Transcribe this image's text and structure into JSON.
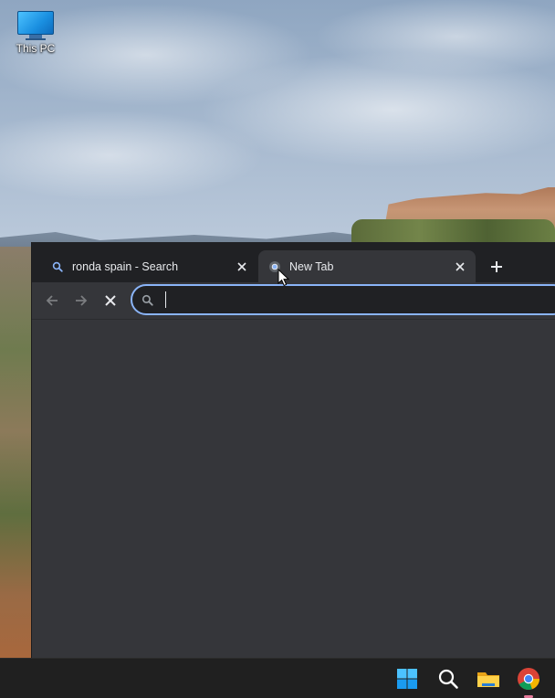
{
  "desktop": {
    "icons": [
      {
        "label": "This PC",
        "icon": "monitor-icon"
      }
    ]
  },
  "browser": {
    "tabs": [
      {
        "title": "ronda spain - Search",
        "icon": "search-icon",
        "active": false
      },
      {
        "title": "New Tab",
        "icon": "chrome-icon",
        "active": true
      }
    ],
    "new_tab_icon": "plus-icon",
    "nav": {
      "back_icon": "arrow-left-icon",
      "forward_icon": "arrow-right-icon",
      "stop_icon": "close-icon"
    },
    "omnibox": {
      "value": "",
      "placeholder": "",
      "icon": "search-icon"
    }
  },
  "taskbar": {
    "items": [
      {
        "name": "Start",
        "icon": "windows-icon"
      },
      {
        "name": "Search",
        "icon": "search-icon"
      },
      {
        "name": "File Explorer",
        "icon": "folder-icon"
      },
      {
        "name": "Google Chrome",
        "icon": "chrome-icon"
      }
    ]
  },
  "colors": {
    "tabstrip": "#202124",
    "toolbar": "#35363a",
    "omnibox_focus": "#8ab4f8",
    "taskbar": "#202020"
  }
}
